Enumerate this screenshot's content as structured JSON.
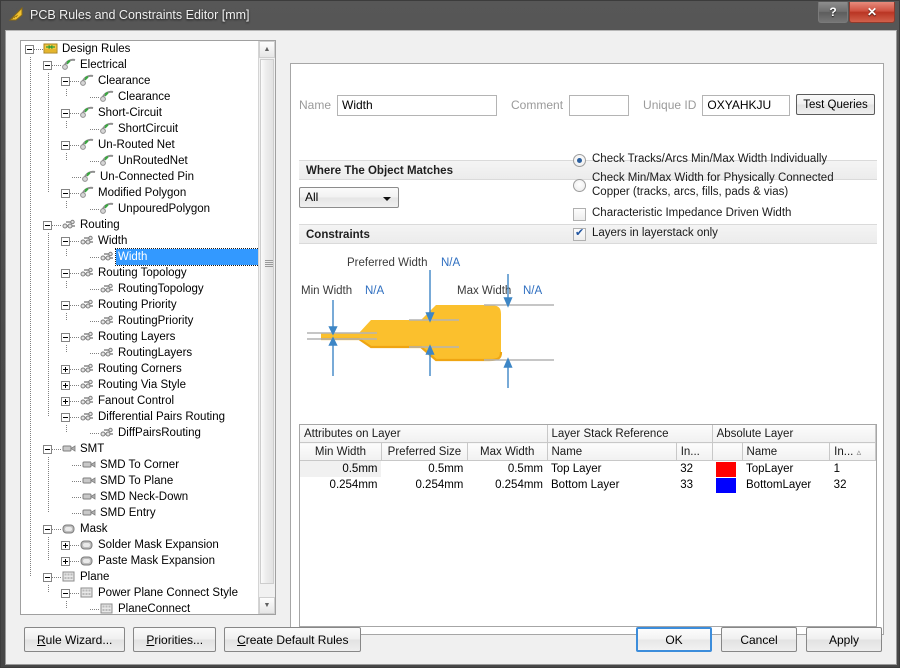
{
  "window": {
    "title": "PCB Rules and Constraints Editor [mm]",
    "icon": "ruler-triangle-icon",
    "help_label": "?",
    "close_label": "✕"
  },
  "tree": {
    "items": [
      {
        "label": "Design Rules",
        "depth": 0,
        "expander": "minus",
        "icon": "design-rules-folder-icon",
        "selected": false
      },
      {
        "label": "Electrical",
        "depth": 1,
        "expander": "minus",
        "icon": "electrical-icon",
        "selected": false
      },
      {
        "label": "Clearance",
        "depth": 2,
        "expander": "minus",
        "icon": "electrical-icon",
        "selected": false
      },
      {
        "label": "Clearance",
        "depth": 3,
        "expander": "none",
        "icon": "electrical-icon",
        "selected": false
      },
      {
        "label": "Short-Circuit",
        "depth": 2,
        "expander": "minus",
        "icon": "electrical-icon",
        "selected": false
      },
      {
        "label": "ShortCircuit",
        "depth": 3,
        "expander": "none",
        "icon": "electrical-icon",
        "selected": false
      },
      {
        "label": "Un-Routed Net",
        "depth": 2,
        "expander": "minus",
        "icon": "electrical-icon",
        "selected": false
      },
      {
        "label": "UnRoutedNet",
        "depth": 3,
        "expander": "none",
        "icon": "electrical-icon",
        "selected": false
      },
      {
        "label": "Un-Connected Pin",
        "depth": 2,
        "expander": "none",
        "icon": "electrical-icon",
        "selected": false
      },
      {
        "label": "Modified Polygon",
        "depth": 2,
        "expander": "minus",
        "icon": "electrical-icon",
        "selected": false
      },
      {
        "label": "UnpouredPolygon",
        "depth": 3,
        "expander": "none",
        "icon": "electrical-icon",
        "selected": false
      },
      {
        "label": "Routing",
        "depth": 1,
        "expander": "minus",
        "icon": "routing-icon",
        "selected": false
      },
      {
        "label": "Width",
        "depth": 2,
        "expander": "minus",
        "icon": "routing-icon",
        "selected": false
      },
      {
        "label": "Width",
        "depth": 3,
        "expander": "none",
        "icon": "routing-icon",
        "selected": true
      },
      {
        "label": "Routing Topology",
        "depth": 2,
        "expander": "minus",
        "icon": "routing-icon",
        "selected": false
      },
      {
        "label": "RoutingTopology",
        "depth": 3,
        "expander": "none",
        "icon": "routing-icon",
        "selected": false
      },
      {
        "label": "Routing Priority",
        "depth": 2,
        "expander": "minus",
        "icon": "routing-icon",
        "selected": false
      },
      {
        "label": "RoutingPriority",
        "depth": 3,
        "expander": "none",
        "icon": "routing-icon",
        "selected": false
      },
      {
        "label": "Routing Layers",
        "depth": 2,
        "expander": "minus",
        "icon": "routing-icon",
        "selected": false
      },
      {
        "label": "RoutingLayers",
        "depth": 3,
        "expander": "none",
        "icon": "routing-icon",
        "selected": false
      },
      {
        "label": "Routing Corners",
        "depth": 2,
        "expander": "plus",
        "icon": "routing-icon",
        "selected": false
      },
      {
        "label": "Routing Via Style",
        "depth": 2,
        "expander": "plus",
        "icon": "routing-icon",
        "selected": false
      },
      {
        "label": "Fanout Control",
        "depth": 2,
        "expander": "plus",
        "icon": "routing-icon",
        "selected": false
      },
      {
        "label": "Differential Pairs Routing",
        "depth": 2,
        "expander": "minus",
        "icon": "routing-icon",
        "selected": false
      },
      {
        "label": "DiffPairsRouting",
        "depth": 3,
        "expander": "none",
        "icon": "routing-icon",
        "selected": false
      },
      {
        "label": "SMT",
        "depth": 1,
        "expander": "minus",
        "icon": "smt-icon",
        "selected": false
      },
      {
        "label": "SMD To Corner",
        "depth": 2,
        "expander": "none",
        "icon": "smt-icon",
        "selected": false
      },
      {
        "label": "SMD To Plane",
        "depth": 2,
        "expander": "none",
        "icon": "smt-icon",
        "selected": false
      },
      {
        "label": "SMD Neck-Down",
        "depth": 2,
        "expander": "none",
        "icon": "smt-icon",
        "selected": false
      },
      {
        "label": "SMD Entry",
        "depth": 2,
        "expander": "none",
        "icon": "smt-icon",
        "selected": false
      },
      {
        "label": "Mask",
        "depth": 1,
        "expander": "minus",
        "icon": "mask-icon",
        "selected": false
      },
      {
        "label": "Solder Mask Expansion",
        "depth": 2,
        "expander": "plus",
        "icon": "mask-icon",
        "selected": false
      },
      {
        "label": "Paste Mask Expansion",
        "depth": 2,
        "expander": "plus",
        "icon": "mask-icon",
        "selected": false
      },
      {
        "label": "Plane",
        "depth": 1,
        "expander": "minus",
        "icon": "plane-icon",
        "selected": false
      },
      {
        "label": "Power Plane Connect Style",
        "depth": 2,
        "expander": "minus",
        "icon": "plane-icon",
        "selected": false
      },
      {
        "label": "PlaneConnect",
        "depth": 3,
        "expander": "none",
        "icon": "plane-icon",
        "selected": false
      }
    ],
    "scroll_up_glyph": "▲",
    "scroll_down_glyph": "▼"
  },
  "form": {
    "name_label": "Name",
    "name_value": "Width",
    "comment_label": "Comment",
    "comment_value": "",
    "unique_id_label": "Unique ID",
    "unique_id_value": "OXYAHKJU",
    "test_queries_label": "Test Queries"
  },
  "where_section": {
    "header": "Where The Object Matches",
    "scope_value": "All"
  },
  "constraints": {
    "header": "Constraints",
    "diagram": {
      "preferred_width_label": "Preferred Width",
      "preferred_width_value": "N/A",
      "min_width_label": "Min Width",
      "min_width_value": "N/A",
      "max_width_label": "Max Width",
      "max_width_value": "N/A",
      "track_color": "#FBC02D",
      "arrow_color": "#3d86c6"
    },
    "options": [
      {
        "type": "radio",
        "label": "Check Tracks/Arcs Min/Max Width Individually",
        "checked": true
      },
      {
        "type": "radio",
        "label": "Check Min/Max Width for Physically Connected Copper (tracks, arcs, fills, pads & vias)",
        "checked": false
      },
      {
        "type": "checkbox",
        "label": "Characteristic Impedance Driven Width",
        "checked": false
      },
      {
        "type": "checkbox",
        "label": "Layers in layerstack only",
        "checked": true
      }
    ]
  },
  "table": {
    "group_headers": [
      {
        "label": "Attributes on Layer"
      },
      {
        "label": "Layer Stack Reference"
      },
      {
        "label": "Absolute Layer"
      }
    ],
    "columns": [
      {
        "label": "Min Width"
      },
      {
        "label": "Preferred Size"
      },
      {
        "label": "Max Width"
      },
      {
        "label": "Name"
      },
      {
        "label": "In..."
      },
      {
        "label": ""
      },
      {
        "label": "Name"
      },
      {
        "label": "In..."
      }
    ],
    "sort_indicator": "▵",
    "rows": [
      {
        "min_width": "0.5mm",
        "preferred_size": "0.5mm",
        "max_width": "0.5mm",
        "stack_name": "Top Layer",
        "stack_index": "32",
        "color": "#FF0000",
        "abs_name": "TopLayer",
        "abs_index": "1"
      },
      {
        "min_width": "0.254mm",
        "preferred_size": "0.254mm",
        "max_width": "0.254mm",
        "stack_name": "Bottom Layer",
        "stack_index": "33",
        "color": "#0000FF",
        "abs_name": "BottomLayer",
        "abs_index": "32"
      }
    ]
  },
  "footer": {
    "rule_wizard": "Rule Wizard...",
    "rule_wizard_mnemonic": "R",
    "priorities": "Priorities...",
    "priorities_mnemonic": "P",
    "create_default_rules": "Create Default Rules",
    "create_default_rules_mnemonic": "C",
    "ok": "OK",
    "cancel": "Cancel",
    "apply": "Apply"
  }
}
